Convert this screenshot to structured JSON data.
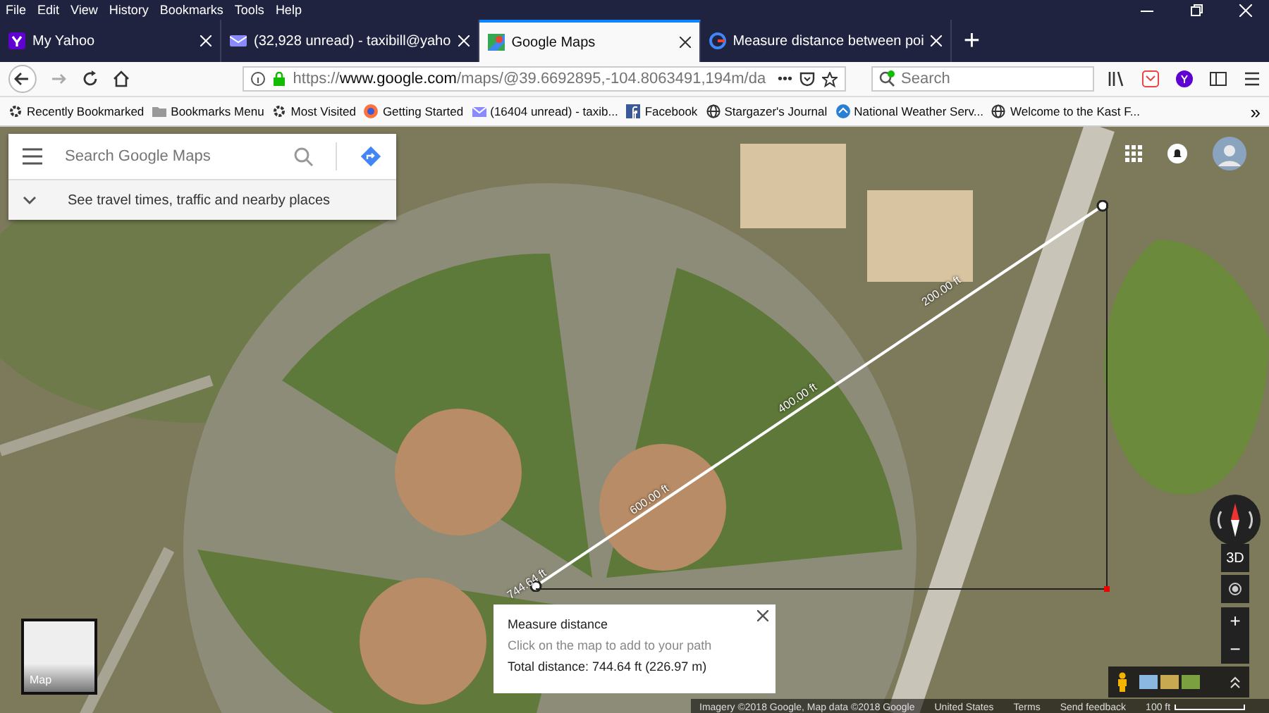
{
  "menu": [
    "File",
    "Edit",
    "View",
    "History",
    "Bookmarks",
    "Tools",
    "Help"
  ],
  "tabs": [
    {
      "label": "My Yahoo",
      "selected": false
    },
    {
      "label": "(32,928 unread) - taxibill@yaho",
      "selected": false
    },
    {
      "label": "Google Maps",
      "selected": true
    },
    {
      "label": "Measure distance between poi",
      "selected": false
    }
  ],
  "new_tab": "+",
  "address_bar": {
    "url": "https://**www.google.com**/maps/@39.6692895,-104.8063491,194m/da",
    "more": "•••"
  },
  "browser_search": {
    "placeholder": "Search"
  },
  "bookmarks": [
    "Recently Bookmarked",
    "Bookmarks Menu",
    "Most Visited",
    "Getting Started",
    "(16404 unread) - taxib...",
    "Facebook",
    "Stargazer's Journal",
    "National Weather Serv...",
    "Welcome to the Kast F..."
  ],
  "bookmarks_overflow": "»",
  "maps_search": {
    "placeholder": "Search Google Maps"
  },
  "travel_hint": "See travel times, traffic and nearby places",
  "measure_labels": [
    "200.00 ft",
    "400.00 ft",
    "600.00 ft",
    "744.64 ft"
  ],
  "tilt_button": "3D",
  "zoom_buttons": [
    "+",
    "−"
  ],
  "layer_toggle": "Map",
  "measure_card": {
    "title": "Measure distance",
    "hint": "Click on the map to add to your path",
    "total": "Total distance: 744.64 ft (226.97 m)"
  },
  "footer": [
    "Imagery ©2018 Google, Map data ©2018 Google",
    "United States",
    "Terms",
    "Send feedback"
  ],
  "scale": "100 ft"
}
